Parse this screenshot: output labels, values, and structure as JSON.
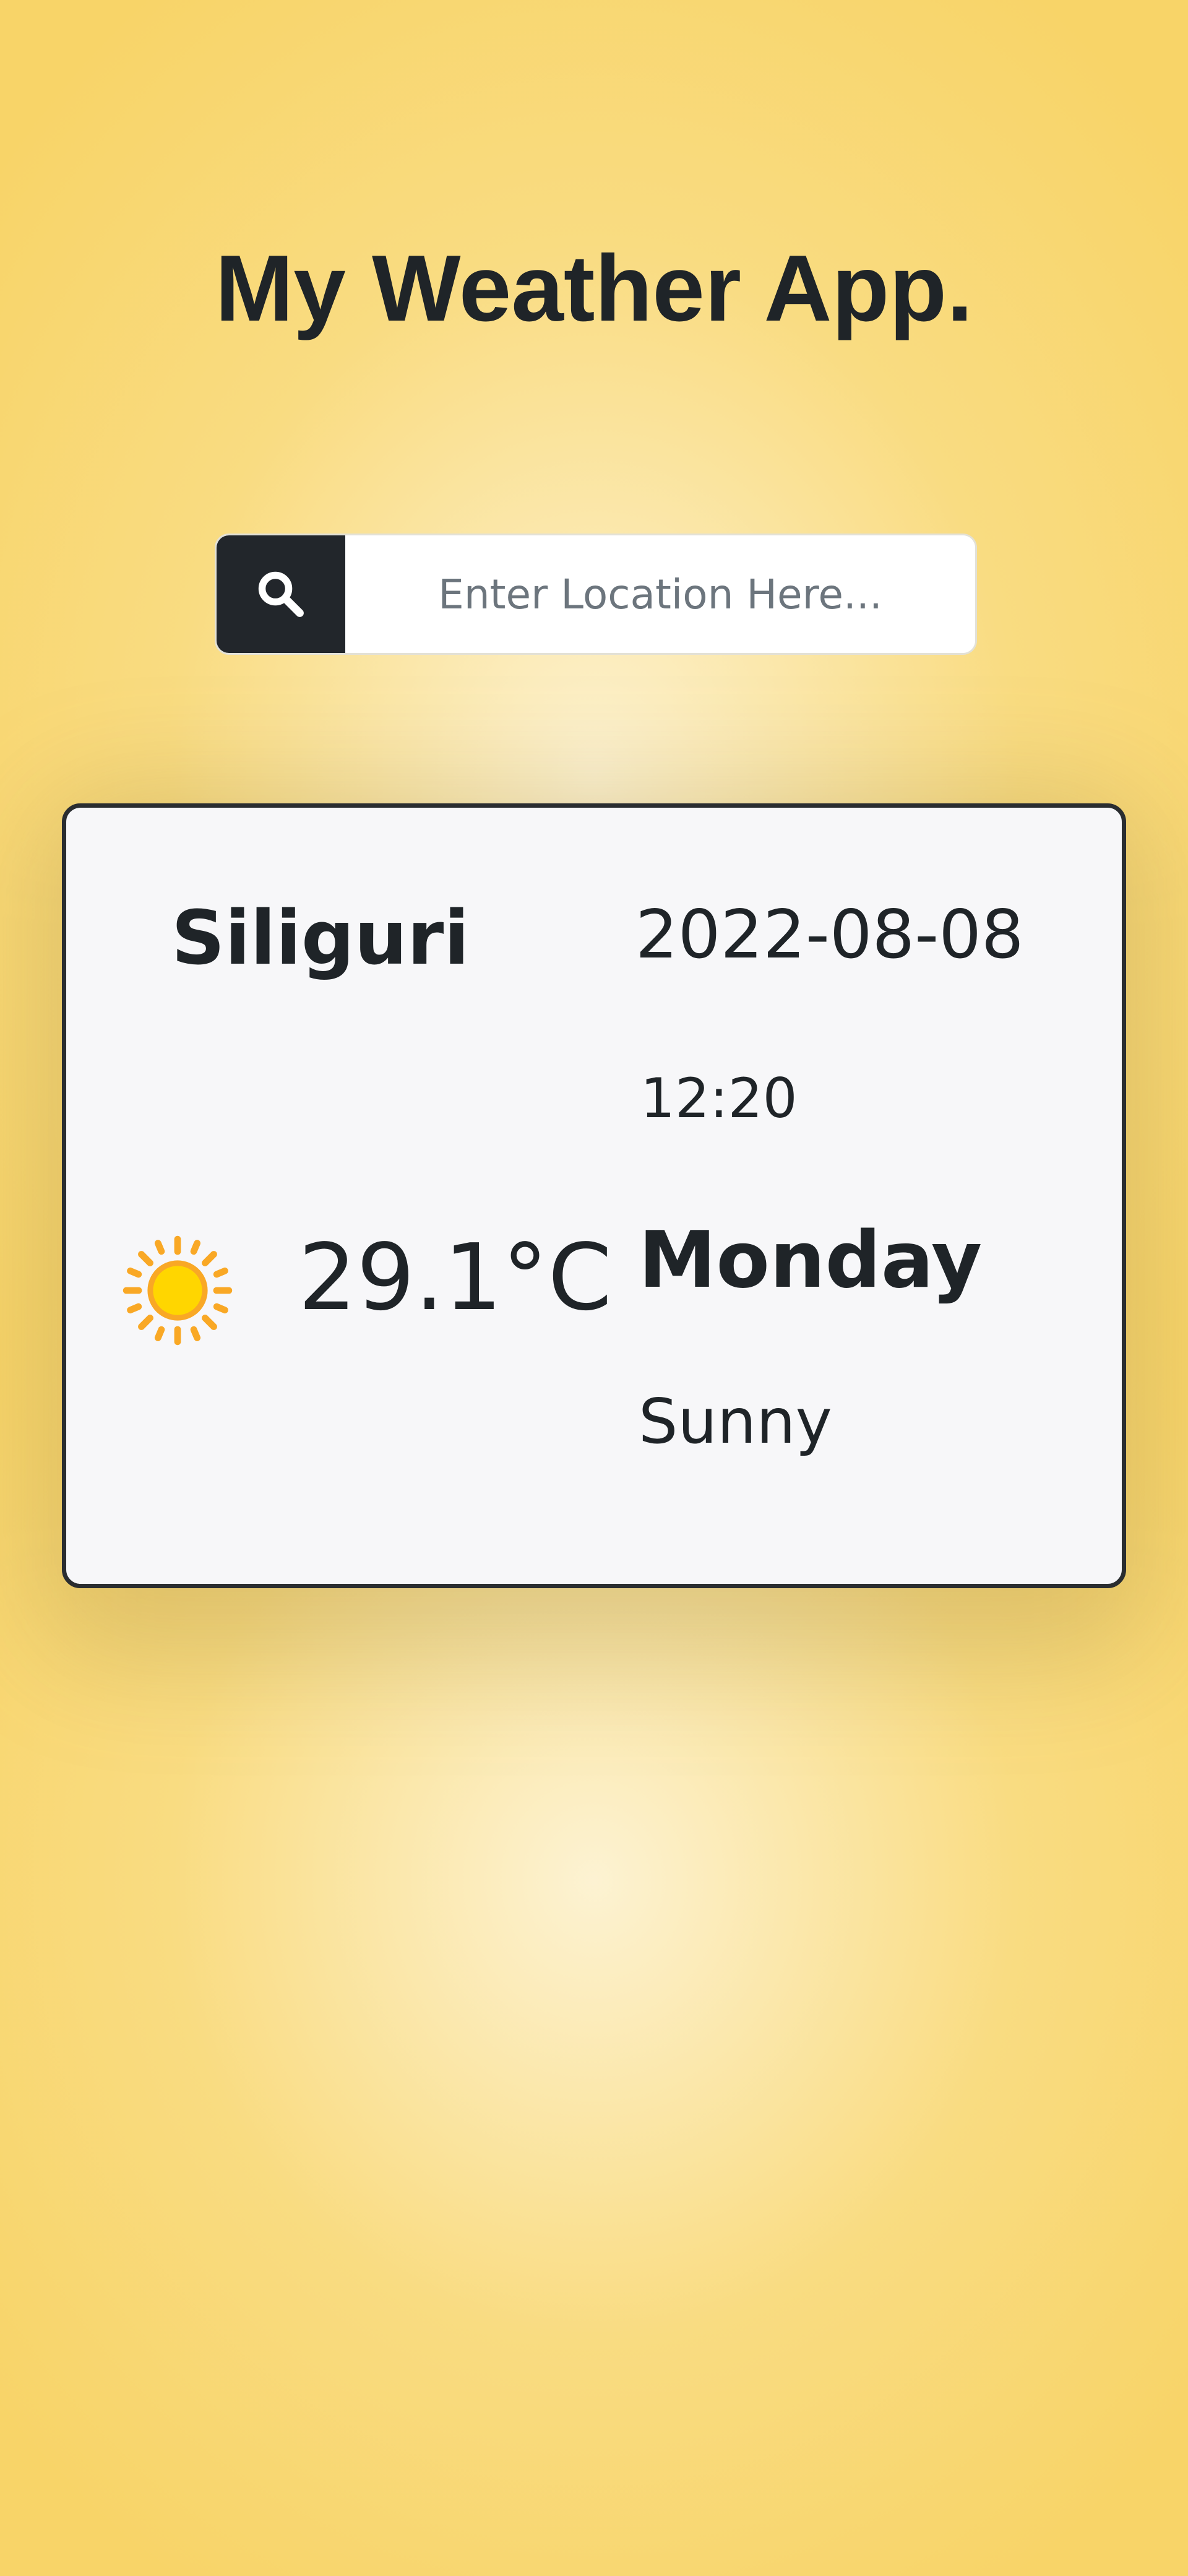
{
  "app": {
    "title": "My Weather App."
  },
  "search": {
    "placeholder": "Enter Location Here...",
    "value": "",
    "button_icon": "search-icon"
  },
  "weather": {
    "location": "Siliguri",
    "date": "2022-08-08",
    "time": "12:20",
    "temperature": "29.1°C",
    "day": "Monday",
    "condition": "Sunny",
    "condition_icon": "sun-icon"
  },
  "colors": {
    "background": "#f8d468",
    "card_background": "#f7f7f9",
    "card_border": "#2a2d30",
    "search_button": "#22262b",
    "text": "#1f2428",
    "sun_core": "#ffd600",
    "sun_rays": "#f9a825"
  }
}
